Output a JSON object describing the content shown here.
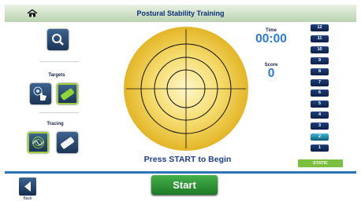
{
  "header": {
    "title": "Postural Stability Training",
    "home_icon": "home-icon"
  },
  "tools": {
    "zoom_icon": "magnifier-icon",
    "targets_label": "Targets",
    "targets": [
      {
        "icon": "hand-target-icon",
        "selected": false
      },
      {
        "icon": "eraser-target-icon",
        "selected": true
      }
    ],
    "tracing_label": "Tracing",
    "tracing": [
      {
        "icon": "tracing-path-icon",
        "selected": true
      },
      {
        "icon": "eraser-tracing-icon",
        "selected": false
      }
    ]
  },
  "stats": {
    "time_label": "Time",
    "time_value": "00:00",
    "score_label": "Score",
    "score_value": "0"
  },
  "levels": {
    "items": [
      "12",
      "11",
      "10",
      "9",
      "8",
      "7",
      "6",
      "5",
      "4",
      "3",
      "2",
      "1"
    ],
    "selected": "2",
    "mode": "STATIC"
  },
  "main": {
    "prompt": "Press START to Begin"
  },
  "footer": {
    "back_label": "Back",
    "start_label": "Start"
  },
  "colors": {
    "accent_blue": "#2a7bd6",
    "title_blue": "#0d2f78",
    "start_green": "#2f9a35",
    "static_green": "#7bbf3f",
    "target_gold": "#e7c13a"
  }
}
